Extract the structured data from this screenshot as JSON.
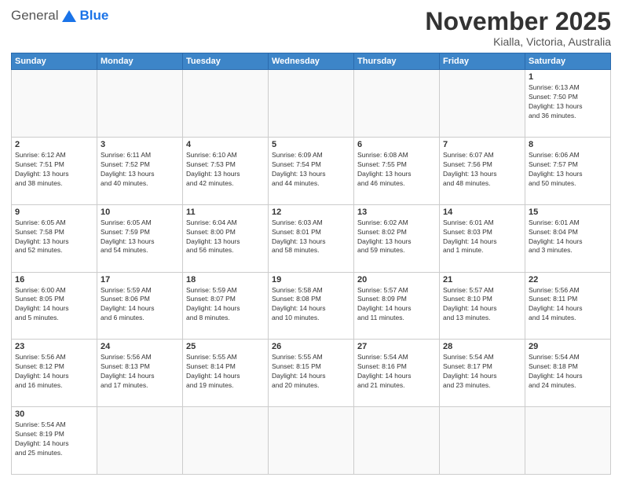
{
  "header": {
    "logo_general": "General",
    "logo_blue": "Blue",
    "month_title": "November 2025",
    "location": "Kialla, Victoria, Australia"
  },
  "weekdays": [
    "Sunday",
    "Monday",
    "Tuesday",
    "Wednesday",
    "Thursday",
    "Friday",
    "Saturday"
  ],
  "rows": [
    [
      {
        "day": "",
        "info": ""
      },
      {
        "day": "",
        "info": ""
      },
      {
        "day": "",
        "info": ""
      },
      {
        "day": "",
        "info": ""
      },
      {
        "day": "",
        "info": ""
      },
      {
        "day": "",
        "info": ""
      },
      {
        "day": "1",
        "info": "Sunrise: 6:13 AM\nSunset: 7:50 PM\nDaylight: 13 hours\nand 36 minutes."
      }
    ],
    [
      {
        "day": "2",
        "info": "Sunrise: 6:12 AM\nSunset: 7:51 PM\nDaylight: 13 hours\nand 38 minutes."
      },
      {
        "day": "3",
        "info": "Sunrise: 6:11 AM\nSunset: 7:52 PM\nDaylight: 13 hours\nand 40 minutes."
      },
      {
        "day": "4",
        "info": "Sunrise: 6:10 AM\nSunset: 7:53 PM\nDaylight: 13 hours\nand 42 minutes."
      },
      {
        "day": "5",
        "info": "Sunrise: 6:09 AM\nSunset: 7:54 PM\nDaylight: 13 hours\nand 44 minutes."
      },
      {
        "day": "6",
        "info": "Sunrise: 6:08 AM\nSunset: 7:55 PM\nDaylight: 13 hours\nand 46 minutes."
      },
      {
        "day": "7",
        "info": "Sunrise: 6:07 AM\nSunset: 7:56 PM\nDaylight: 13 hours\nand 48 minutes."
      },
      {
        "day": "8",
        "info": "Sunrise: 6:06 AM\nSunset: 7:57 PM\nDaylight: 13 hours\nand 50 minutes."
      }
    ],
    [
      {
        "day": "9",
        "info": "Sunrise: 6:05 AM\nSunset: 7:58 PM\nDaylight: 13 hours\nand 52 minutes."
      },
      {
        "day": "10",
        "info": "Sunrise: 6:05 AM\nSunset: 7:59 PM\nDaylight: 13 hours\nand 54 minutes."
      },
      {
        "day": "11",
        "info": "Sunrise: 6:04 AM\nSunset: 8:00 PM\nDaylight: 13 hours\nand 56 minutes."
      },
      {
        "day": "12",
        "info": "Sunrise: 6:03 AM\nSunset: 8:01 PM\nDaylight: 13 hours\nand 58 minutes."
      },
      {
        "day": "13",
        "info": "Sunrise: 6:02 AM\nSunset: 8:02 PM\nDaylight: 13 hours\nand 59 minutes."
      },
      {
        "day": "14",
        "info": "Sunrise: 6:01 AM\nSunset: 8:03 PM\nDaylight: 14 hours\nand 1 minute."
      },
      {
        "day": "15",
        "info": "Sunrise: 6:01 AM\nSunset: 8:04 PM\nDaylight: 14 hours\nand 3 minutes."
      }
    ],
    [
      {
        "day": "16",
        "info": "Sunrise: 6:00 AM\nSunset: 8:05 PM\nDaylight: 14 hours\nand 5 minutes."
      },
      {
        "day": "17",
        "info": "Sunrise: 5:59 AM\nSunset: 8:06 PM\nDaylight: 14 hours\nand 6 minutes."
      },
      {
        "day": "18",
        "info": "Sunrise: 5:59 AM\nSunset: 8:07 PM\nDaylight: 14 hours\nand 8 minutes."
      },
      {
        "day": "19",
        "info": "Sunrise: 5:58 AM\nSunset: 8:08 PM\nDaylight: 14 hours\nand 10 minutes."
      },
      {
        "day": "20",
        "info": "Sunrise: 5:57 AM\nSunset: 8:09 PM\nDaylight: 14 hours\nand 11 minutes."
      },
      {
        "day": "21",
        "info": "Sunrise: 5:57 AM\nSunset: 8:10 PM\nDaylight: 14 hours\nand 13 minutes."
      },
      {
        "day": "22",
        "info": "Sunrise: 5:56 AM\nSunset: 8:11 PM\nDaylight: 14 hours\nand 14 minutes."
      }
    ],
    [
      {
        "day": "23",
        "info": "Sunrise: 5:56 AM\nSunset: 8:12 PM\nDaylight: 14 hours\nand 16 minutes."
      },
      {
        "day": "24",
        "info": "Sunrise: 5:56 AM\nSunset: 8:13 PM\nDaylight: 14 hours\nand 17 minutes."
      },
      {
        "day": "25",
        "info": "Sunrise: 5:55 AM\nSunset: 8:14 PM\nDaylight: 14 hours\nand 19 minutes."
      },
      {
        "day": "26",
        "info": "Sunrise: 5:55 AM\nSunset: 8:15 PM\nDaylight: 14 hours\nand 20 minutes."
      },
      {
        "day": "27",
        "info": "Sunrise: 5:54 AM\nSunset: 8:16 PM\nDaylight: 14 hours\nand 21 minutes."
      },
      {
        "day": "28",
        "info": "Sunrise: 5:54 AM\nSunset: 8:17 PM\nDaylight: 14 hours\nand 23 minutes."
      },
      {
        "day": "29",
        "info": "Sunrise: 5:54 AM\nSunset: 8:18 PM\nDaylight: 14 hours\nand 24 minutes."
      }
    ],
    [
      {
        "day": "30",
        "info": "Sunrise: 5:54 AM\nSunset: 8:19 PM\nDaylight: 14 hours\nand 25 minutes."
      },
      {
        "day": "",
        "info": ""
      },
      {
        "day": "",
        "info": ""
      },
      {
        "day": "",
        "info": ""
      },
      {
        "day": "",
        "info": ""
      },
      {
        "day": "",
        "info": ""
      },
      {
        "day": "",
        "info": ""
      }
    ]
  ]
}
